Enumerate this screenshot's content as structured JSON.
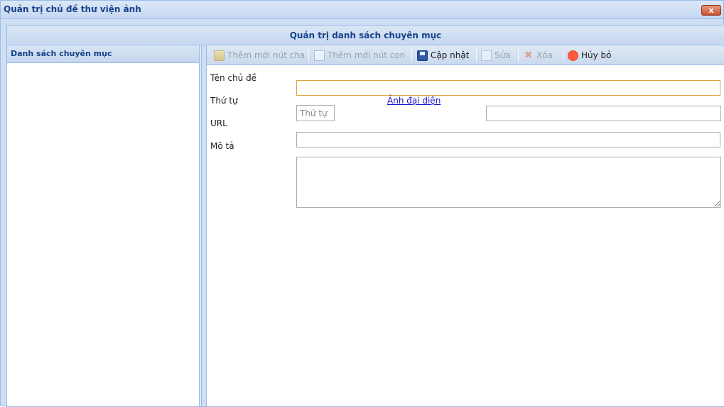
{
  "window": {
    "title": "Quản trị chủ đề thư viện ảnh",
    "close_label": "x"
  },
  "panel": {
    "title": "Quản trị danh sách chuyên mục"
  },
  "left_panel": {
    "title": "Danh sách chuyên mục"
  },
  "toolbar": {
    "add_parent": {
      "label": "Thêm mới nút cha",
      "icon": "folder-icon",
      "enabled": false
    },
    "add_child": {
      "label": "Thêm mới nút con",
      "icon": "page-icon",
      "enabled": false
    },
    "save": {
      "label": "Cập nhật",
      "icon": "save-icon",
      "enabled": true
    },
    "edit": {
      "label": "Sửa",
      "icon": "edit-icon",
      "enabled": false
    },
    "delete": {
      "label": "Xóa",
      "icon": "delete-icon",
      "enabled": false
    },
    "cancel": {
      "label": "Hủy bỏ",
      "icon": "stop-icon",
      "enabled": true
    }
  },
  "form": {
    "name_label": "Tên chủ đề",
    "name_value": "",
    "order_label": "Thứ tự",
    "order_placeholder": "Thứ tự",
    "image_link": "Ảnh đại diện",
    "image_value": "",
    "url_label": "URL",
    "url_value": "",
    "desc_label": "Mô tả",
    "desc_value": ""
  },
  "colors": {
    "accent": "#15428b",
    "border": "#99bbe8",
    "focus": "#e0a238",
    "link": "#1111cc"
  }
}
